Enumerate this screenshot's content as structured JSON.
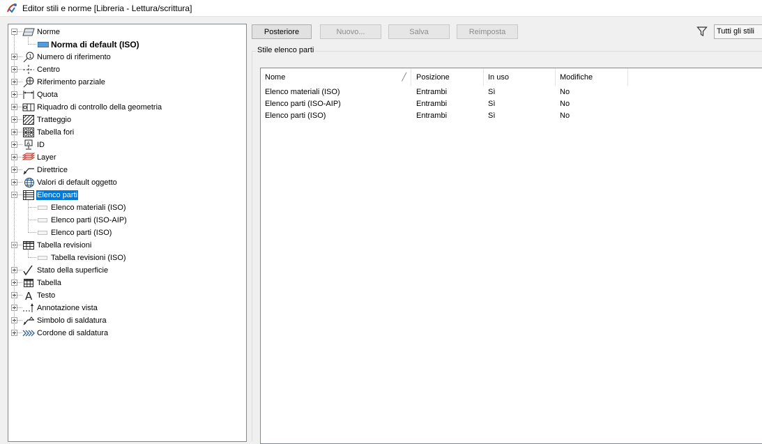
{
  "window": {
    "title": "Editor stili e norme [Libreria - Lettura/scrittura]"
  },
  "tree": {
    "items": [
      {
        "label": "Norme",
        "level": 0,
        "expander": "minus",
        "icon": "standard-icon"
      },
      {
        "label": "Norma di default (ISO)",
        "level": 1,
        "icon": "default-standard-icon",
        "bold": true
      },
      {
        "label": "Numero di riferimento",
        "level": 0,
        "expander": "plus",
        "icon": "balloon-icon"
      },
      {
        "label": "Centro",
        "level": 0,
        "expander": "plus",
        "icon": "center-mark-icon"
      },
      {
        "label": "Riferimento parziale",
        "level": 0,
        "expander": "plus",
        "icon": "datum-target-icon"
      },
      {
        "label": "Quota",
        "level": 0,
        "expander": "plus",
        "icon": "dimension-icon"
      },
      {
        "label": "Riquadro di controllo della geometria",
        "level": 0,
        "expander": "plus",
        "icon": "feature-control-frame-icon"
      },
      {
        "label": "Tratteggio",
        "level": 0,
        "expander": "plus",
        "icon": "hatch-icon"
      },
      {
        "label": "Tabella fori",
        "level": 0,
        "expander": "plus",
        "icon": "hole-table-icon"
      },
      {
        "label": "ID",
        "level": 0,
        "expander": "plus",
        "icon": "id-icon"
      },
      {
        "label": "Layer",
        "level": 0,
        "expander": "plus",
        "icon": "layers-icon"
      },
      {
        "label": "Direttrice",
        "level": 0,
        "expander": "plus",
        "icon": "leader-icon"
      },
      {
        "label": "Valori di default oggetto",
        "level": 0,
        "expander": "plus",
        "icon": "globe-icon"
      },
      {
        "label": "Elenco parti",
        "level": 0,
        "expander": "minus",
        "icon": "parts-list-icon",
        "selected": true
      },
      {
        "label": "Elenco materiali (ISO)",
        "level": 1,
        "icon": "style-item-icon"
      },
      {
        "label": "Elenco parti (ISO-AIP)",
        "level": 1,
        "icon": "style-item-icon"
      },
      {
        "label": "Elenco parti (ISO)",
        "level": 1,
        "icon": "style-item-icon"
      },
      {
        "label": "Tabella revisioni",
        "level": 0,
        "expander": "minus",
        "icon": "revision-table-icon"
      },
      {
        "label": "Tabella revisioni (ISO)",
        "level": 1,
        "icon": "style-item-icon"
      },
      {
        "label": "Stato della superficie",
        "level": 0,
        "expander": "plus",
        "icon": "surface-texture-icon"
      },
      {
        "label": "Tabella",
        "level": 0,
        "expander": "plus",
        "icon": "table-icon"
      },
      {
        "label": "Testo",
        "level": 0,
        "expander": "plus",
        "icon": "text-icon"
      },
      {
        "label": "Annotazione vista",
        "level": 0,
        "expander": "plus",
        "icon": "view-annotation-icon"
      },
      {
        "label": "Simbolo di saldatura",
        "level": 0,
        "expander": "plus",
        "icon": "weld-symbol-icon"
      },
      {
        "label": "Cordone di saldatura",
        "level": 0,
        "expander": "plus",
        "icon": "weld-bead-icon"
      }
    ]
  },
  "toolbar": {
    "back_label": "Posteriore",
    "new_label": "Nuovo...",
    "save_label": "Salva",
    "reset_label": "Reimposta",
    "filter_value": "Tutti gli stili"
  },
  "group": {
    "label": "Stile elenco parti"
  },
  "list": {
    "columns": [
      "Nome",
      "Posizione",
      "In uso",
      "Modifiche"
    ],
    "rows": [
      [
        "Elenco materiali (ISO)",
        "Entrambi",
        "Sì",
        "No"
      ],
      [
        "Elenco parti (ISO-AIP)",
        "Entrambi",
        "Sì",
        "No"
      ],
      [
        "Elenco parti (ISO)",
        "Entrambi",
        "Sì",
        "No"
      ]
    ]
  },
  "colors": {
    "selection": "#0078d7",
    "panel_border": "#828790"
  }
}
